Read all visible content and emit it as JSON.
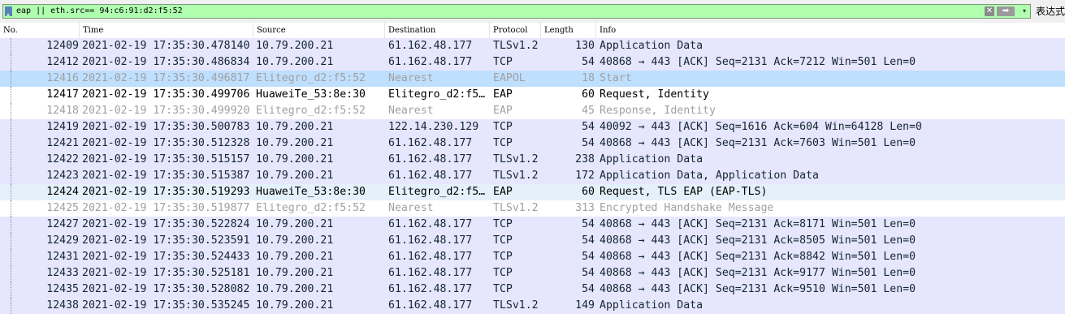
{
  "filter": {
    "value": "eap || eth.src== 94:c6:91:d2:f5:52",
    "clear_symbol": "✕",
    "apply_symbol": "➡",
    "dropdown_symbol": "▾",
    "expression_label": "表达式"
  },
  "columns": [
    {
      "key": "no",
      "label": "No."
    },
    {
      "key": "time",
      "label": "Time"
    },
    {
      "key": "source",
      "label": "Source"
    },
    {
      "key": "destination",
      "label": "Destination"
    },
    {
      "key": "protocol",
      "label": "Protocol"
    },
    {
      "key": "length",
      "label": "Length"
    },
    {
      "key": "info",
      "label": "Info"
    }
  ],
  "colors": {
    "tcp_bg": "#e7e6ff",
    "eapol_bg": "#bfdfff",
    "eap_bg": "#ffffff",
    "eap_highlight_bg": "#e4f1fb",
    "text": "#12272e",
    "dim_text": "#a0a0a0"
  },
  "packets": [
    {
      "no": "12409",
      "time": "2021-02-19 17:35:30.478140",
      "source": "10.79.200.21",
      "destination": "61.162.48.177",
      "protocol": "TLSv1.2",
      "length": "130",
      "info": "Application Data",
      "bg": "#e7e6ff",
      "fg": "#12272e"
    },
    {
      "no": "12412",
      "time": "2021-02-19 17:35:30.486834",
      "source": "10.79.200.21",
      "destination": "61.162.48.177",
      "protocol": "TCP",
      "length": "54",
      "info": "40868 → 443 [ACK] Seq=2131 Ack=7212 Win=501 Len=0",
      "bg": "#e7e6ff",
      "fg": "#12272e"
    },
    {
      "no": "12416",
      "time": "2021-02-19 17:35:30.496817",
      "source": "Elitegro_d2:f5:52",
      "destination": "Nearest",
      "protocol": "EAPOL",
      "length": "18",
      "info": "Start",
      "bg": "#bfdfff",
      "fg": "#a0a0a0"
    },
    {
      "no": "12417",
      "time": "2021-02-19 17:35:30.499706",
      "source": "HuaweiTe_53:8e:30",
      "destination": "Elitegro_d2:f5…",
      "protocol": "EAP",
      "length": "60",
      "info": "Request, Identity",
      "bg": "#ffffff",
      "fg": "#000000"
    },
    {
      "no": "12418",
      "time": "2021-02-19 17:35:30.499920",
      "source": "Elitegro_d2:f5:52",
      "destination": "Nearest",
      "protocol": "EAP",
      "length": "45",
      "info": "Response, Identity",
      "bg": "#ffffff",
      "fg": "#a0a0a0"
    },
    {
      "no": "12419",
      "time": "2021-02-19 17:35:30.500783",
      "source": "10.79.200.21",
      "destination": "122.14.230.129",
      "protocol": "TCP",
      "length": "54",
      "info": "40092 → 443 [ACK] Seq=1616 Ack=604 Win=64128 Len=0",
      "bg": "#e7e6ff",
      "fg": "#12272e"
    },
    {
      "no": "12421",
      "time": "2021-02-19 17:35:30.512328",
      "source": "10.79.200.21",
      "destination": "61.162.48.177",
      "protocol": "TCP",
      "length": "54",
      "info": "40868 → 443 [ACK] Seq=2131 Ack=7603 Win=501 Len=0",
      "bg": "#e7e6ff",
      "fg": "#12272e"
    },
    {
      "no": "12422",
      "time": "2021-02-19 17:35:30.515157",
      "source": "10.79.200.21",
      "destination": "61.162.48.177",
      "protocol": "TLSv1.2",
      "length": "238",
      "info": "Application Data",
      "bg": "#e7e6ff",
      "fg": "#12272e"
    },
    {
      "no": "12423",
      "time": "2021-02-19 17:35:30.515387",
      "source": "10.79.200.21",
      "destination": "61.162.48.177",
      "protocol": "TLSv1.2",
      "length": "172",
      "info": "Application Data, Application Data",
      "bg": "#e7e6ff",
      "fg": "#12272e"
    },
    {
      "no": "12424",
      "time": "2021-02-19 17:35:30.519293",
      "source": "HuaweiTe_53:8e:30",
      "destination": "Elitegro_d2:f5…",
      "protocol": "EAP",
      "length": "60",
      "info": "Request, TLS EAP (EAP-TLS)",
      "bg": "#e4f1fb",
      "fg": "#000000"
    },
    {
      "no": "12425",
      "time": "2021-02-19 17:35:30.519877",
      "source": "Elitegro_d2:f5:52",
      "destination": "Nearest",
      "protocol": "TLSv1.2",
      "length": "313",
      "info": "Encrypted Handshake Message",
      "bg": "#ffffff",
      "fg": "#a0a0a0"
    },
    {
      "no": "12427",
      "time": "2021-02-19 17:35:30.522824",
      "source": "10.79.200.21",
      "destination": "61.162.48.177",
      "protocol": "TCP",
      "length": "54",
      "info": "40868 → 443 [ACK] Seq=2131 Ack=8171 Win=501 Len=0",
      "bg": "#e7e6ff",
      "fg": "#12272e"
    },
    {
      "no": "12429",
      "time": "2021-02-19 17:35:30.523591",
      "source": "10.79.200.21",
      "destination": "61.162.48.177",
      "protocol": "TCP",
      "length": "54",
      "info": "40868 → 443 [ACK] Seq=2131 Ack=8505 Win=501 Len=0",
      "bg": "#e7e6ff",
      "fg": "#12272e"
    },
    {
      "no": "12431",
      "time": "2021-02-19 17:35:30.524433",
      "source": "10.79.200.21",
      "destination": "61.162.48.177",
      "protocol": "TCP",
      "length": "54",
      "info": "40868 → 443 [ACK] Seq=2131 Ack=8842 Win=501 Len=0",
      "bg": "#e7e6ff",
      "fg": "#12272e"
    },
    {
      "no": "12433",
      "time": "2021-02-19 17:35:30.525181",
      "source": "10.79.200.21",
      "destination": "61.162.48.177",
      "protocol": "TCP",
      "length": "54",
      "info": "40868 → 443 [ACK] Seq=2131 Ack=9177 Win=501 Len=0",
      "bg": "#e7e6ff",
      "fg": "#12272e"
    },
    {
      "no": "12435",
      "time": "2021-02-19 17:35:30.528082",
      "source": "10.79.200.21",
      "destination": "61.162.48.177",
      "protocol": "TCP",
      "length": "54",
      "info": "40868 → 443 [ACK] Seq=2131 Ack=9510 Win=501 Len=0",
      "bg": "#e7e6ff",
      "fg": "#12272e"
    },
    {
      "no": "12438",
      "time": "2021-02-19 17:35:30.535245",
      "source": "10.79.200.21",
      "destination": "61.162.48.177",
      "protocol": "TLSv1.2",
      "length": "149",
      "info": "Application Data",
      "bg": "#e7e6ff",
      "fg": "#12272e"
    }
  ]
}
